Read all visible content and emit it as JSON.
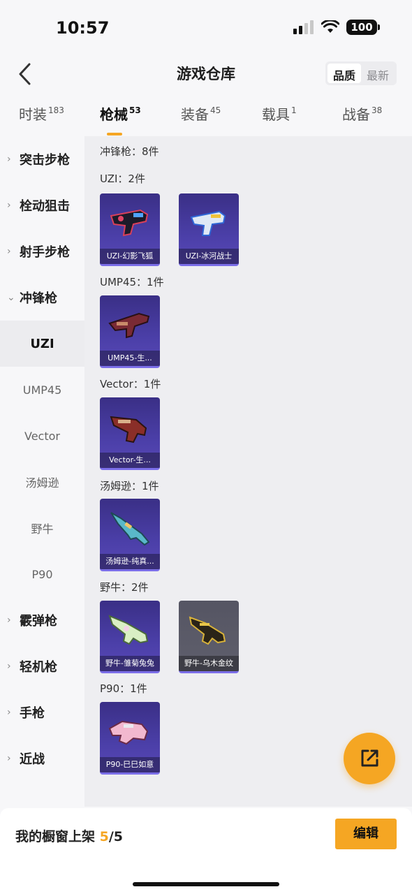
{
  "status": {
    "time": "10:57",
    "battery": "100"
  },
  "header": {
    "title": "游戏仓库",
    "sort": [
      "品质",
      "最新"
    ]
  },
  "tabs": [
    {
      "label": "时装",
      "count": "183"
    },
    {
      "label": "枪械",
      "count": "53"
    },
    {
      "label": "装备",
      "count": "45"
    },
    {
      "label": "载具",
      "count": "1"
    },
    {
      "label": "战备",
      "count": "38"
    }
  ],
  "sidebar": {
    "items": [
      {
        "label": "突击步枪",
        "chevron": "›"
      },
      {
        "label": "栓动狙击",
        "chevron": "›"
      },
      {
        "label": "射手步枪",
        "chevron": "›"
      },
      {
        "label": "冲锋枪",
        "chevron": "⌄"
      },
      {
        "label": "UZI"
      },
      {
        "label": "UMP45"
      },
      {
        "label": "Vector"
      },
      {
        "label": "汤姆逊"
      },
      {
        "label": "野牛"
      },
      {
        "label": "P90"
      },
      {
        "label": "霰弹枪",
        "chevron": "›"
      },
      {
        "label": "轻机枪",
        "chevron": "›"
      },
      {
        "label": "手枪",
        "chevron": "›"
      },
      {
        "label": "近战",
        "chevron": "›"
      }
    ]
  },
  "main": {
    "category_title": "冲锋枪：8件",
    "groups": [
      {
        "title": "UZI：2件",
        "items": [
          "UZI-幻影飞狐",
          "UZI-冰河战士"
        ]
      },
      {
        "title": "UMP45：1件",
        "items": [
          "UMP45-生..."
        ]
      },
      {
        "title": "Vector：1件",
        "items": [
          "Vector-生..."
        ]
      },
      {
        "title": "汤姆逊：1件",
        "items": [
          "汤姆逊-纯真..."
        ]
      },
      {
        "title": "野牛：2件",
        "items": [
          "野牛-雏菊兔兔",
          "野牛-乌木金纹"
        ]
      },
      {
        "title": "P90：1件",
        "items": [
          "P90-巳巳如意"
        ]
      }
    ]
  },
  "bottom": {
    "label": "我的橱窗上架 ",
    "count": "5",
    "total": "/5",
    "edit": "编辑"
  },
  "colors": {
    "accent": "#f5a623",
    "card_purple": "#4b3fa8",
    "card_gray": "#5f5f6c"
  },
  "icons": {
    "back": "chevron-left-icon",
    "share": "share-external-icon"
  }
}
